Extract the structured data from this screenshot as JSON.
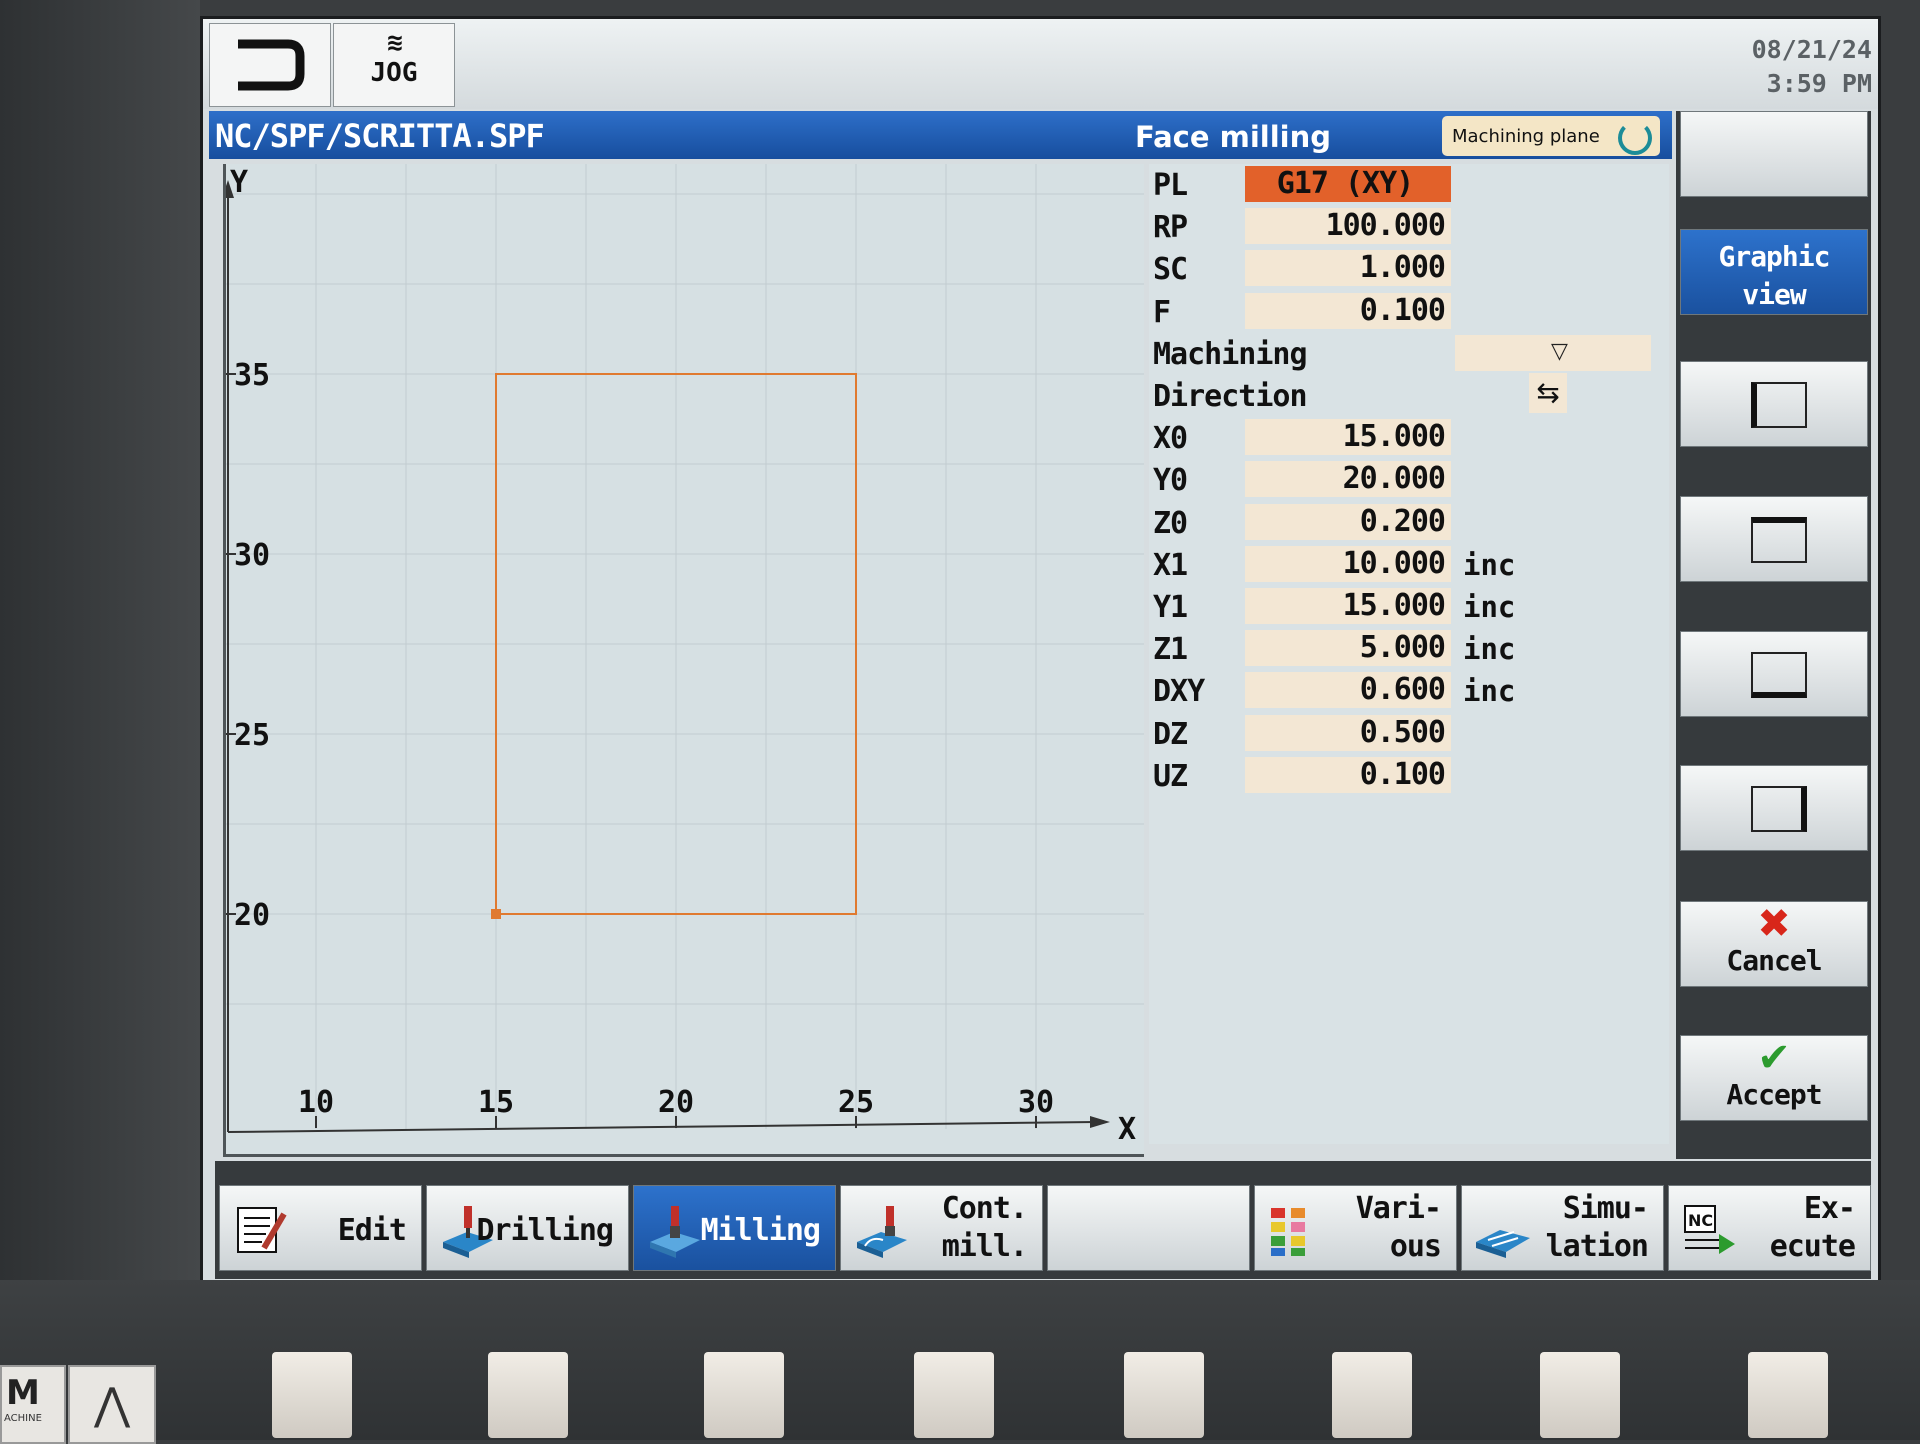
{
  "header": {
    "mode": "JOG",
    "date": "08/21/24",
    "time": "3:59 PM"
  },
  "pathbar": {
    "path": "NC/SPF/SCRITTA.SPF",
    "cycle_title": "Face milling",
    "machining_plane_label": "Machining plane"
  },
  "graphic": {
    "x_axis_label": "X",
    "y_axis_label": "Y",
    "x_ticks": [
      "10",
      "15",
      "20",
      "25",
      "30"
    ],
    "y_ticks": [
      "35",
      "30",
      "25",
      "20"
    ],
    "contour_color": "#e07a30"
  },
  "params": [
    {
      "name": "PL",
      "value": "G17 (XY)",
      "unit": ""
    },
    {
      "name": "RP",
      "value": "100.000",
      "unit": ""
    },
    {
      "name": "SC",
      "value": "1.000",
      "unit": ""
    },
    {
      "name": "F",
      "value": "0.100",
      "unit": ""
    },
    {
      "name": "Machining",
      "value": "▽",
      "unit": ""
    },
    {
      "name": "Direction",
      "value": "⇆",
      "unit": ""
    },
    {
      "name": "X0",
      "value": "15.000",
      "unit": ""
    },
    {
      "name": "Y0",
      "value": "20.000",
      "unit": ""
    },
    {
      "name": "Z0",
      "value": "0.200",
      "unit": ""
    },
    {
      "name": "X1",
      "value": "10.000",
      "unit": "inc"
    },
    {
      "name": "Y1",
      "value": "15.000",
      "unit": "inc"
    },
    {
      "name": "Z1",
      "value": "5.000",
      "unit": "inc"
    },
    {
      "name": "DXY",
      "value": "0.600",
      "unit": "inc"
    },
    {
      "name": "DZ",
      "value": "0.500",
      "unit": ""
    },
    {
      "name": "UZ",
      "value": "0.100",
      "unit": ""
    }
  ],
  "vertical_softkeys": {
    "graphic_view": "Graphic\nview",
    "cancel": "Cancel",
    "accept": "Accept"
  },
  "horizontal_softkeys": [
    {
      "label": "Edit",
      "icon": "edit-icon"
    },
    {
      "label": "Drilling",
      "icon": "drilling-icon"
    },
    {
      "label": "Milling",
      "icon": "milling-icon"
    },
    {
      "label": "Cont.\nmill.",
      "icon": "contour-milling-icon"
    },
    {
      "label": "",
      "icon": ""
    },
    {
      "label": "Vari-\nous",
      "icon": "various-icon"
    },
    {
      "label": "Simu-\nlation",
      "icon": "simulation-icon"
    },
    {
      "label": "Ex-\necute",
      "icon": "execute-icon"
    }
  ],
  "hardware": {
    "machine_key": "M",
    "machine_key_sub": "ACHINE"
  }
}
